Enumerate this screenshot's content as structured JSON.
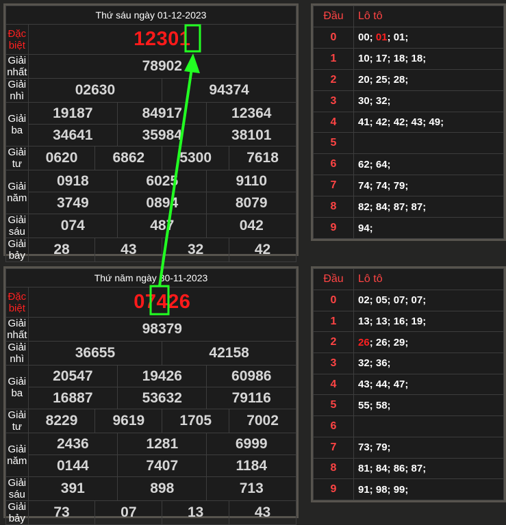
{
  "results": [
    {
      "title": "Thứ sáu ngày 01-12-2023",
      "labels": [
        "Đặc biệt",
        "Giải nhất",
        "Giải nhì",
        "Giải ba",
        "Giải tư",
        "Giải năm",
        "Giải sáu",
        "Giải bảy"
      ],
      "db": "12301",
      "g1": "78902",
      "g2": [
        "02630",
        "94374"
      ],
      "g3": [
        "19187",
        "84917",
        "12364",
        "34641",
        "35984",
        "38101"
      ],
      "g4": [
        "0620",
        "6862",
        "5300",
        "7618"
      ],
      "g5": [
        "0918",
        "6025",
        "9110",
        "3749",
        "0894",
        "8079"
      ],
      "g6": [
        "074",
        "487",
        "042"
      ],
      "g7": [
        "28",
        "43",
        "32",
        "42"
      ]
    },
    {
      "title": "Thứ năm ngày 30-11-2023",
      "labels": [
        "Đặc biệt",
        "Giải nhất",
        "Giải nhì",
        "Giải ba",
        "Giải tư",
        "Giải năm",
        "Giải sáu",
        "Giải bảy"
      ],
      "db": "07426",
      "g1": "98379",
      "g2": [
        "36655",
        "42158"
      ],
      "g3": [
        "20547",
        "19426",
        "60986",
        "16887",
        "53632",
        "79116"
      ],
      "g4": [
        "8229",
        "9619",
        "1705",
        "7002"
      ],
      "g5": [
        "2436",
        "1281",
        "6999",
        "0144",
        "7407",
        "1184"
      ],
      "g6": [
        "391",
        "898",
        "713"
      ],
      "g7": [
        "73",
        "07",
        "13",
        "43"
      ]
    }
  ],
  "loto": [
    {
      "header": [
        "Đầu",
        "Lô tô"
      ],
      "rows": [
        {
          "d": "0",
          "parts": [
            {
              "t": "00; "
            },
            {
              "t": "01",
              "hl": true
            },
            {
              "t": "; 01;"
            }
          ]
        },
        {
          "d": "1",
          "parts": [
            {
              "t": "10; 17; 18; 18;"
            }
          ]
        },
        {
          "d": "2",
          "parts": [
            {
              "t": "20; 25; 28;"
            }
          ]
        },
        {
          "d": "3",
          "parts": [
            {
              "t": "30; 32;"
            }
          ]
        },
        {
          "d": "4",
          "parts": [
            {
              "t": "41; 42; 42; 43; 49;"
            }
          ]
        },
        {
          "d": "5",
          "parts": [
            {
              "t": ""
            }
          ]
        },
        {
          "d": "6",
          "parts": [
            {
              "t": "62; 64;"
            }
          ]
        },
        {
          "d": "7",
          "parts": [
            {
              "t": "74; 74; 79;"
            }
          ]
        },
        {
          "d": "8",
          "parts": [
            {
              "t": "82; 84; 87; 87;"
            }
          ]
        },
        {
          "d": "9",
          "parts": [
            {
              "t": "94;"
            }
          ]
        }
      ]
    },
    {
      "header": [
        "Đầu",
        "Lô tô"
      ],
      "rows": [
        {
          "d": "0",
          "parts": [
            {
              "t": "02; 05; 07; 07;"
            }
          ]
        },
        {
          "d": "1",
          "parts": [
            {
              "t": "13; 13; 16; 19;"
            }
          ]
        },
        {
          "d": "2",
          "parts": [
            {
              "t": "26",
              "hl": true
            },
            {
              "t": "; 26; 29;"
            }
          ]
        },
        {
          "d": "3",
          "parts": [
            {
              "t": "32; 36;"
            }
          ]
        },
        {
          "d": "4",
          "parts": [
            {
              "t": "43; 44; 47;"
            }
          ]
        },
        {
          "d": "5",
          "parts": [
            {
              "t": "55; 58;"
            }
          ]
        },
        {
          "d": "6",
          "parts": [
            {
              "t": ""
            }
          ]
        },
        {
          "d": "7",
          "parts": [
            {
              "t": "73; 79;"
            }
          ]
        },
        {
          "d": "8",
          "parts": [
            {
              "t": "81; 84; 86; 87;"
            }
          ]
        },
        {
          "d": "9",
          "parts": [
            {
              "t": "91; 98; 99;"
            }
          ]
        }
      ]
    }
  ],
  "colors": {
    "accent_red": "#ff1a1a",
    "arrow_green": "#22ff22",
    "frame": "#57544e"
  }
}
